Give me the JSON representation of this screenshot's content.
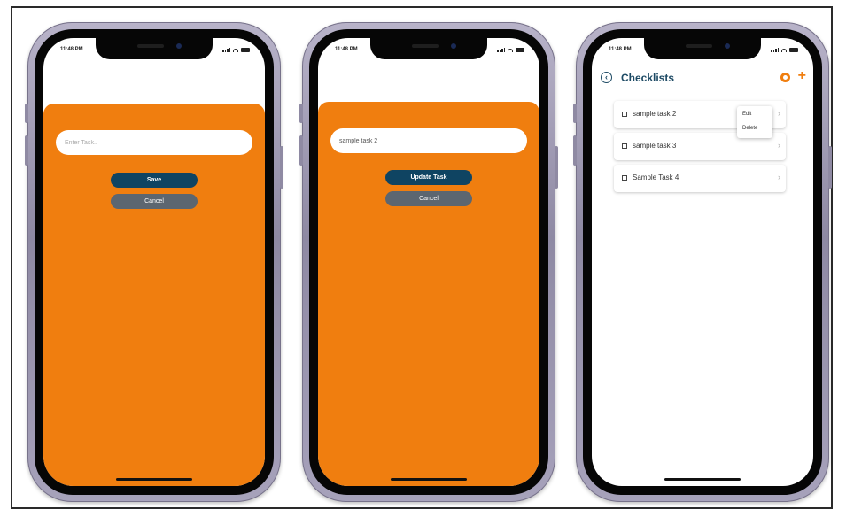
{
  "phones": [
    {
      "status_time": "11:48 PM",
      "input_value": "",
      "input_placeholder": "Enter Task..",
      "primary_button": "Save",
      "secondary_button": "Cancel"
    },
    {
      "status_time": "11:48 PM",
      "input_value": "sample task 2",
      "input_placeholder": "",
      "primary_button": "Update Task",
      "secondary_button": "Cancel"
    },
    {
      "status_time": "11:48 PM",
      "nav_title": "Checklists",
      "tasks": [
        {
          "label": "sample task 2"
        },
        {
          "label": "sample task 3"
        },
        {
          "label": "Sample Task 4"
        }
      ],
      "context_menu": {
        "edit": "Edit",
        "delete": "Delete"
      }
    }
  ],
  "colors": {
    "accent_orange": "#f07e0f",
    "primary_navy": "#0f4462",
    "secondary_gray": "#5c6670",
    "title_blue": "#1d4a64"
  },
  "icons": [
    "back-circle-icon",
    "sync-icon",
    "plus-icon",
    "checkbox-icon",
    "chevron-right-icon"
  ]
}
